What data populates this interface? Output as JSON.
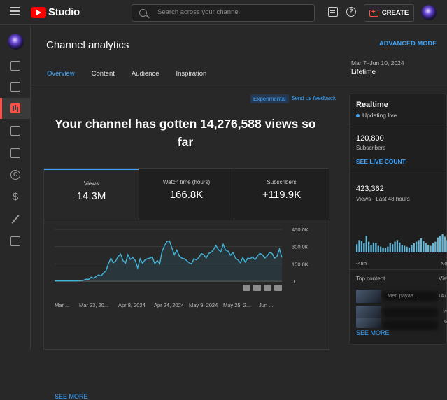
{
  "app": {
    "logo_text": "Studio"
  },
  "search": {
    "placeholder": "Search across your channel"
  },
  "header": {
    "create_label": "CREATE",
    "help_glyph": "?"
  },
  "sidebar": {
    "items": [
      {
        "name": "dashboard",
        "icon": "dashboard-icon"
      },
      {
        "name": "content",
        "icon": "video-icon"
      },
      {
        "name": "analytics",
        "icon": "analytics-icon",
        "active": true
      },
      {
        "name": "comments",
        "icon": "comments-icon"
      },
      {
        "name": "subtitles",
        "icon": "subtitles-icon"
      },
      {
        "name": "copyright",
        "icon": "copyright-icon",
        "glyph": "C"
      },
      {
        "name": "earn",
        "icon": "dollar-icon",
        "glyph": "$"
      },
      {
        "name": "customization",
        "icon": "magic-wand-icon"
      },
      {
        "name": "audio-library",
        "icon": "audio-library-icon"
      }
    ]
  },
  "page": {
    "title": "Channel analytics",
    "advanced_mode": "ADVANCED MODE",
    "tabs": [
      {
        "label": "Overview",
        "active": true
      },
      {
        "label": "Content"
      },
      {
        "label": "Audience"
      },
      {
        "label": "Inspiration"
      }
    ],
    "date_range": "Mar 7–Jun 10, 2024",
    "range_name": "Lifetime"
  },
  "overview": {
    "experimental_badge": "Experimental",
    "send_feedback": "Send us feedback",
    "headline": "Your channel has gotten 14,276,588 views so far",
    "metrics": [
      {
        "label": "Views",
        "value": "14.3M"
      },
      {
        "label": "Watch time (hours)",
        "value": "166.8K"
      },
      {
        "label": "Subscribers",
        "value": "+119.9K"
      }
    ],
    "see_more": "SEE MORE"
  },
  "chart_data": {
    "type": "area",
    "series_color": "#41b4d9",
    "y_ticks": [
      "450.0K",
      "300.0K",
      "150.0K",
      "0"
    ],
    "ylim": [
      0,
      450000
    ],
    "x_ticks": [
      "Mar ...",
      "Mar 23, 20...",
      "Apr 8, 2024",
      "Apr 24, 2024",
      "May 9, 2024",
      "May 25, 2...",
      "Jun ..."
    ],
    "values": [
      2000,
      2000,
      2000,
      2000,
      2000,
      2000,
      2000,
      2000,
      2000,
      2000,
      3000,
      5000,
      10000,
      18000,
      15000,
      35000,
      25000,
      40000,
      55000,
      45000,
      70000,
      90000,
      150000,
      200000,
      160000,
      175000,
      215000,
      235000,
      180000,
      155000,
      230000,
      190000,
      205000,
      180000,
      115000,
      195000,
      155000,
      185000,
      195000,
      200000,
      210000,
      150000,
      180000,
      150000,
      260000,
      310000,
      345000,
      350000,
      290000,
      230000,
      270000,
      220000,
      200000,
      195000,
      180000,
      160000,
      150000,
      195000,
      185000,
      205000,
      240000,
      230000,
      200000,
      240000,
      250000,
      275000,
      310000,
      275000,
      255000,
      320000,
      270000,
      260000,
      225000,
      250000,
      200000,
      185000,
      160000,
      205000,
      165000,
      200000,
      195000,
      210000,
      185000,
      220000,
      240000,
      230000,
      200000,
      220000,
      250000,
      240000,
      200000,
      215000,
      280000,
      205000
    ]
  },
  "realtime": {
    "title": "Realtime",
    "status": "Updating live",
    "subscribers_value": "120,800",
    "subscribers_label": "Subscribers",
    "see_live_count": "SEE LIVE COUNT",
    "views_value": "423,362",
    "views_label": "Views · Last 48 hours",
    "axis_start": "-48h",
    "axis_end": "No",
    "bars": [
      20,
      30,
      28,
      22,
      40,
      26,
      18,
      24,
      22,
      16,
      14,
      12,
      10,
      14,
      22,
      20,
      26,
      30,
      24,
      18,
      16,
      14,
      12,
      18,
      22,
      26,
      30,
      34,
      28,
      22,
      18,
      16,
      22,
      26,
      36,
      40,
      44,
      38,
      30
    ],
    "top_content_label": "Top content",
    "top_content_views_label": "View",
    "top_content": [
      {
        "title": "Meri payaa...",
        "views": "147,1"
      },
      {
        "title": "",
        "views": "25"
      },
      {
        "title": "",
        "views": "6"
      },
      {
        "title": "",
        "views": "5"
      }
    ],
    "see_more": "SEE MORE"
  }
}
